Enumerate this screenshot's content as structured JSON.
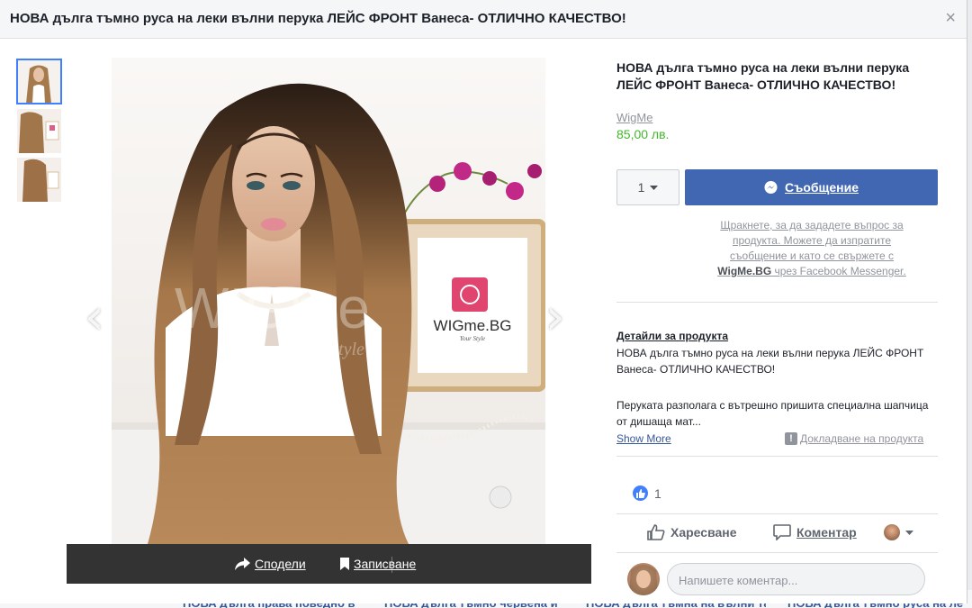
{
  "dialog": {
    "title": "НОВА дълга тъмно руса на леки вълни перука ЛЕЙС ФРОНТ Ванеса- ОТЛИЧНО КАЧЕСТВО!",
    "close_glyph": "×"
  },
  "photo": {
    "watermark_brand": "WIGme",
    "watermark_tag": "Your Style",
    "frame_brand": "WIGme.BG",
    "frame_tag": "Your Style",
    "prev_glyph": "‹",
    "next_glyph": "›"
  },
  "share_bar": {
    "share_label": "Сподели",
    "save_label": "Записване"
  },
  "product": {
    "title": "НОВА дълга тъмно руса на леки вълни перука ЛЕЙС ФРОНТ Ванеса- ОТЛИЧНО КАЧЕСТВО!",
    "seller": "WigMe",
    "price": "85,00 лв.",
    "quantity": "1",
    "message_button": "Съобщение",
    "hint_line1": "Щракнете, за да зададете въпрос за",
    "hint_line2": "продукта. Можете да изпратите",
    "hint_line3": "съобщение и като се свържете с",
    "hint_bold": "WigMe.BG",
    "hint_tail": " чрез Facebook Messenger."
  },
  "details": {
    "heading": "Детайли за продукта",
    "text1": "НОВА дълга тъмно руса на леки вълни перука ЛЕЙС ФРОНТ Ванеса- ОТЛИЧНО КАЧЕСТВО!",
    "text2": "Перуката разполага с вътрешно пришита специална шапчица от дишаща мат...",
    "show_more": "Show More",
    "download": "Докладване на продукта"
  },
  "reactions": {
    "like_count": "1",
    "like_label": "Харесване",
    "comment_label": "Коментар",
    "comment_placeholder": "Напишете коментар..."
  },
  "background_links": [
    "НОВА дълга права поведно в",
    "НОВА дълга тъмно червена и",
    "НОВА дълга тъмна на вълни та",
    "НОВА дълга тъмно руса на ле"
  ],
  "colors": {
    "accent": "#4267b2",
    "price": "#42b72a",
    "share_bar": "#333333"
  }
}
